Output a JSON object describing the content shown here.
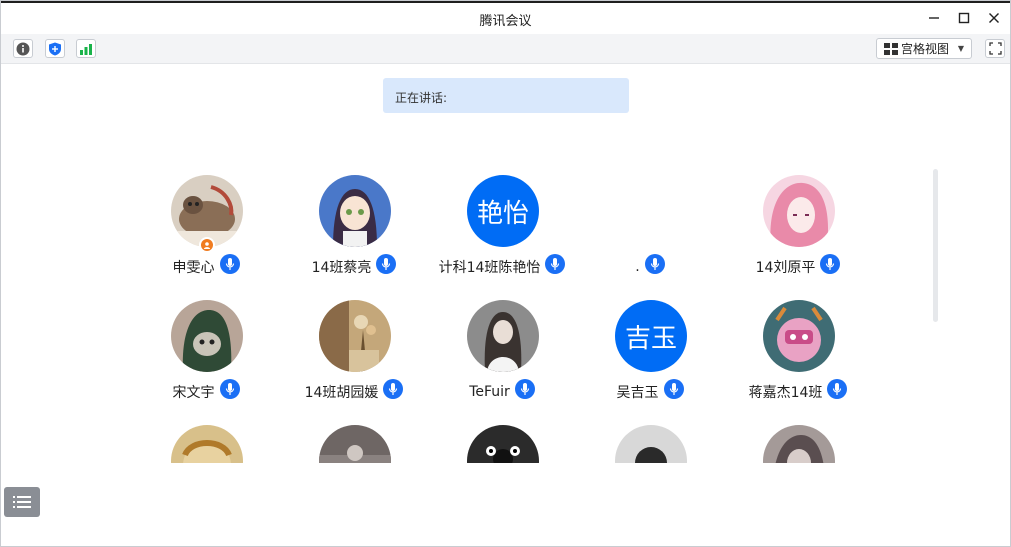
{
  "window": {
    "title": "腾讯会议"
  },
  "toolbar": {
    "view_label": "宫格视图",
    "icons": [
      "info-icon",
      "shield-icon",
      "signal-icon"
    ]
  },
  "speaking": {
    "label": "正在讲话:"
  },
  "participants": [
    {
      "name": "申雯心",
      "avatar_style": "photo-cat",
      "host": true
    },
    {
      "name": "14班蔡亮",
      "avatar_style": "photo-anime-girl",
      "host": false
    },
    {
      "name": "计科14班陈艳怡",
      "avatar_text": "艳怡",
      "host": false
    },
    {
      "name": ".",
      "avatar_style": "none",
      "host": false
    },
    {
      "name": "14刘原平",
      "avatar_style": "photo-pink-anime",
      "host": false
    },
    {
      "name": "宋文宇",
      "avatar_style": "photo-green-hood",
      "host": false
    },
    {
      "name": "14班胡园媛",
      "avatar_style": "photo-flowers",
      "host": false
    },
    {
      "name": "TeFuir",
      "avatar_style": "photo-woman-white",
      "host": false
    },
    {
      "name": "吴吉玉",
      "avatar_text": "吉玉",
      "host": false
    },
    {
      "name": "蒋嘉杰14班",
      "avatar_style": "photo-cartoon-pig",
      "host": false
    }
  ],
  "colors": {
    "accent": "#006cf5",
    "mic": "#1a6ff5",
    "speaking_bg": "#d9e8fc",
    "host_badge": "#f07c20"
  }
}
